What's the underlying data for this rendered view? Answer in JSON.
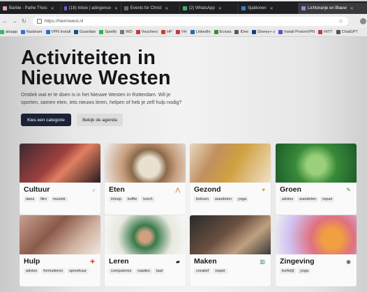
{
  "browser": {
    "tabs": [
      {
        "label": "Barbie - Pathe Thuis",
        "color": "#e0a0c0",
        "active": false
      },
      {
        "label": "(18) Inbox | adingenuo",
        "color": "#6b5fd1",
        "active": false
      },
      {
        "label": "Events for Christ",
        "color": "#6a6a6a",
        "active": false
      },
      {
        "label": "(2) WhatsApp",
        "color": "#3bb56a",
        "active": false
      },
      {
        "label": "Sjablonen",
        "color": "#3b82c4",
        "active": false
      },
      {
        "label": "Lichtoranje en Blauw",
        "color": "#8b8bd8",
        "active": true
      }
    ],
    "url": "https://hierinwest.nl",
    "bookmarks": [
      {
        "label": "atsapp",
        "color": "#3bb56a"
      },
      {
        "label": "Nasbram",
        "color": "#3b6fd1"
      },
      {
        "label": "VPN Install",
        "color": "#2a6ad1"
      },
      {
        "label": "Guardian",
        "color": "#1a4a8a"
      },
      {
        "label": "Spotify",
        "color": "#2bb54a"
      },
      {
        "label": "WD",
        "color": "#777777"
      },
      {
        "label": "Vouchers",
        "color": "#c43a3a"
      },
      {
        "label": "HP",
        "color": "#d13a3a"
      },
      {
        "label": "VH",
        "color": "#c43a3a"
      },
      {
        "label": "LinkedIn",
        "color": "#2a6ab1"
      },
      {
        "label": "Ecosia",
        "color": "#3b8a3a"
      },
      {
        "label": "IDee",
        "color": "#5a5a5a"
      },
      {
        "label": "Disney+ s",
        "color": "#1a3a8a"
      },
      {
        "label": "Install ProtonVPN",
        "color": "#6a4ac4"
      },
      {
        "label": "HITT",
        "color": "#c43a3a"
      },
      {
        "label": "ChatGPT",
        "color": "#555555"
      }
    ]
  },
  "hero": {
    "title": "Activiteiten in Nieuwe Westen",
    "lead": "Ontdek wat er te doen is in het Nieuwe Westen in Rotterdam. Wil je sporten, samen eten, iets nieuws leren, helpen of heb je zelf hulp nodig?",
    "primary_button": "Kies een categorie",
    "secondary_button": "Bekijk de agenda"
  },
  "categories": [
    {
      "title": "Cultuur",
      "tags": [
        "dans",
        "film",
        "muziek"
      ],
      "icon": "music-icon",
      "accent": "#c45ac4"
    },
    {
      "title": "Eten",
      "tags": [
        "inloop",
        "koffie",
        "lunch"
      ],
      "icon": "food-icon",
      "accent": "#d1502a"
    },
    {
      "title": "Gezond",
      "tags": [
        "boksen",
        "wandelen",
        "yoga"
      ],
      "icon": "heart-icon",
      "accent": "#e0a030"
    },
    {
      "title": "Groen",
      "tags": [
        "advies",
        "wandelen",
        "repair"
      ],
      "icon": "plant-icon",
      "accent": "#3b8a3a"
    },
    {
      "title": "Hulp",
      "tags": [
        "advies",
        "formulieren",
        "spreekuur"
      ],
      "icon": "help-icon",
      "accent": "#d1502a"
    },
    {
      "title": "Leren",
      "tags": [
        "computeres",
        "naailes",
        "taal"
      ],
      "icon": "book-icon",
      "accent": "#1a1a1a"
    },
    {
      "title": "Maken",
      "tags": [
        "creatief",
        "repair"
      ],
      "icon": "tools-icon",
      "accent": "#3b8a6a"
    },
    {
      "title": "Zingeving",
      "tags": [
        "leefstijl",
        "yoga"
      ],
      "icon": "spirit-icon",
      "accent": "#555555"
    }
  ]
}
